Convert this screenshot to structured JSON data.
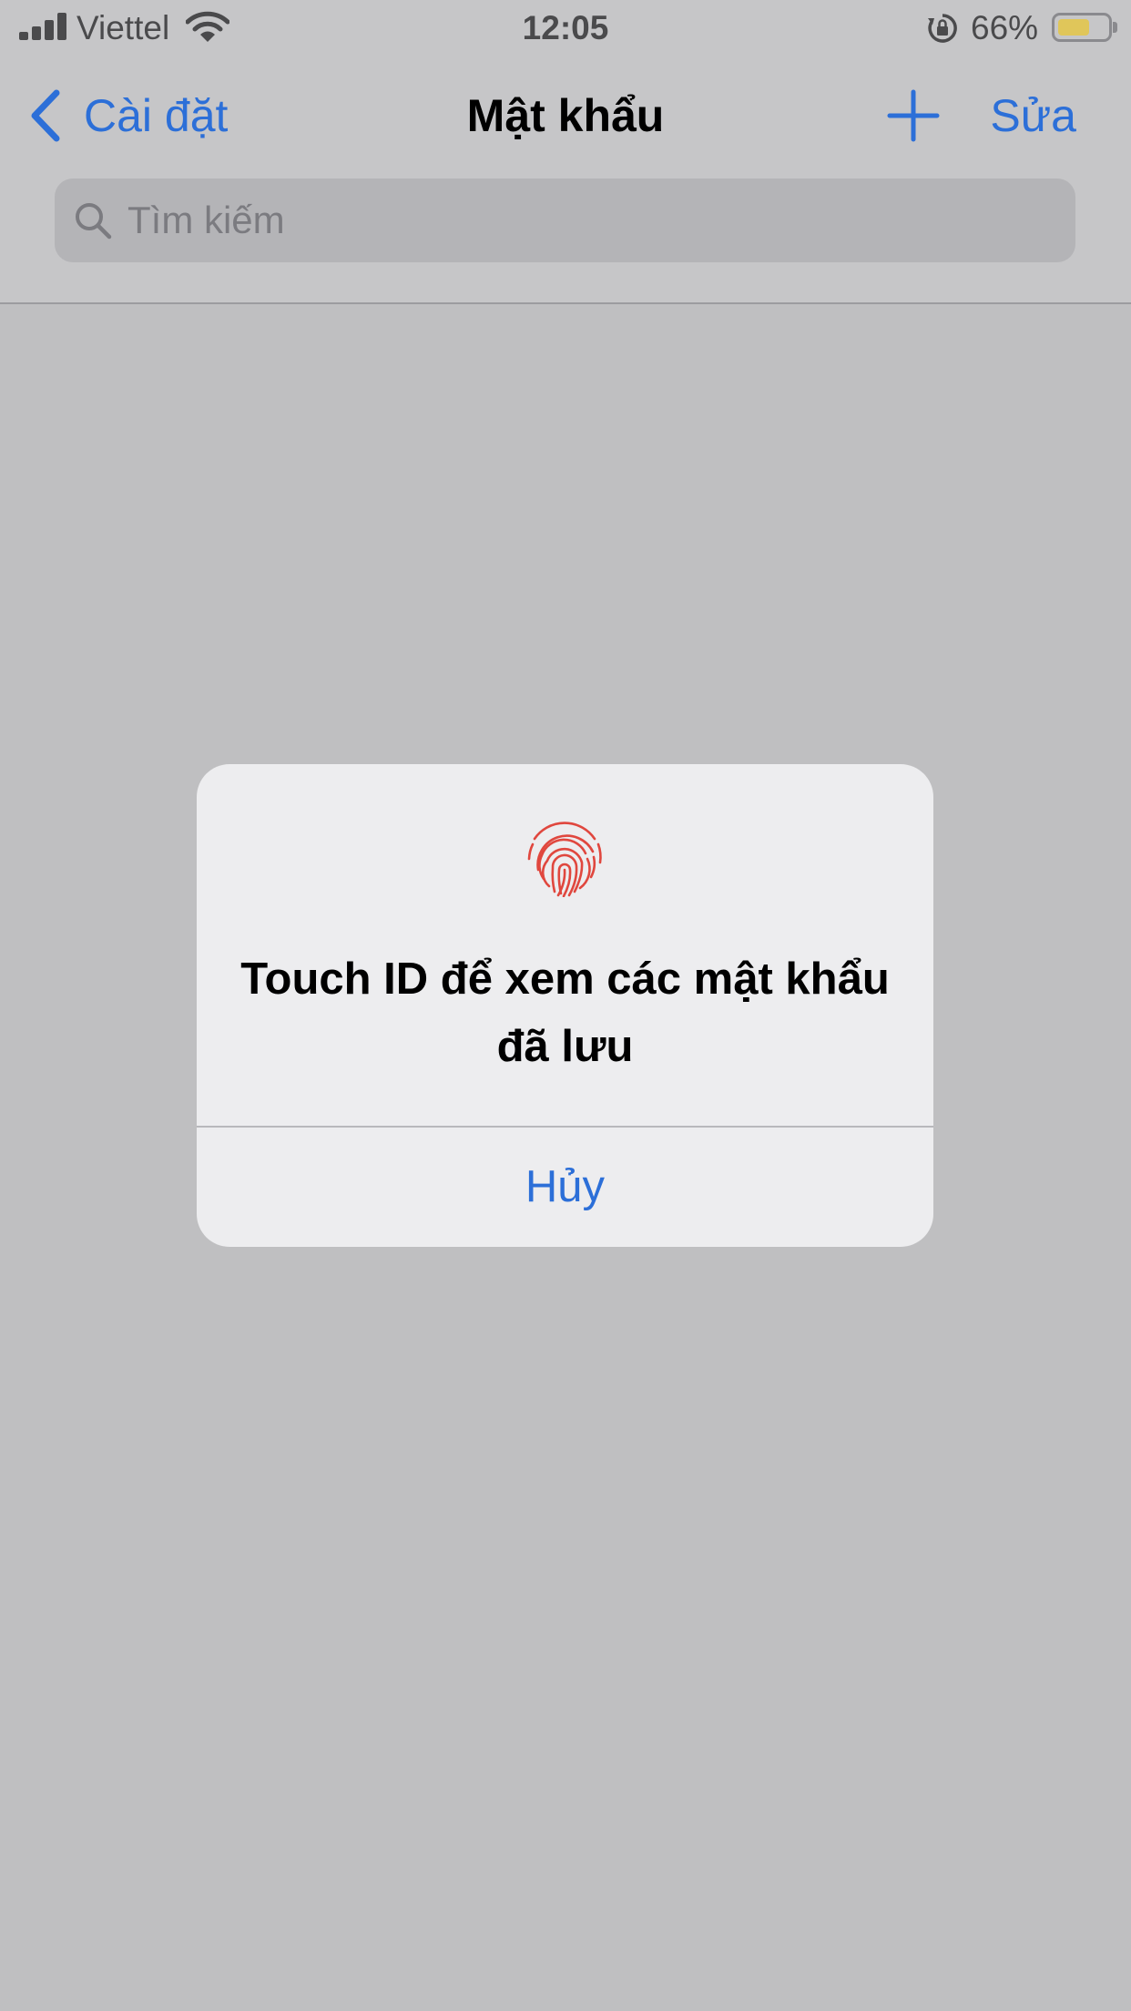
{
  "status_bar": {
    "carrier": "Viettel",
    "time": "12:05",
    "battery_percent_label": "66%",
    "battery_level": 0.66,
    "signal_icon": "signal-bars-icon",
    "wifi_icon": "wifi-icon",
    "orientation_icon": "rotation-lock-icon"
  },
  "nav": {
    "back_label": "Cài đặt",
    "title": "Mật khẩu",
    "add_icon": "plus-icon",
    "edit_label": "Sửa"
  },
  "search": {
    "placeholder": "Tìm kiếm",
    "icon": "search-icon"
  },
  "dialog": {
    "icon": "fingerprint-icon",
    "message": "Touch ID để xem các mật khẩu đã lưu",
    "cancel_label": "Hủy"
  },
  "colors": {
    "accent": "#2c6fd8",
    "fingerprint": "#e0473e",
    "battery_fill": "#e0c65a"
  }
}
